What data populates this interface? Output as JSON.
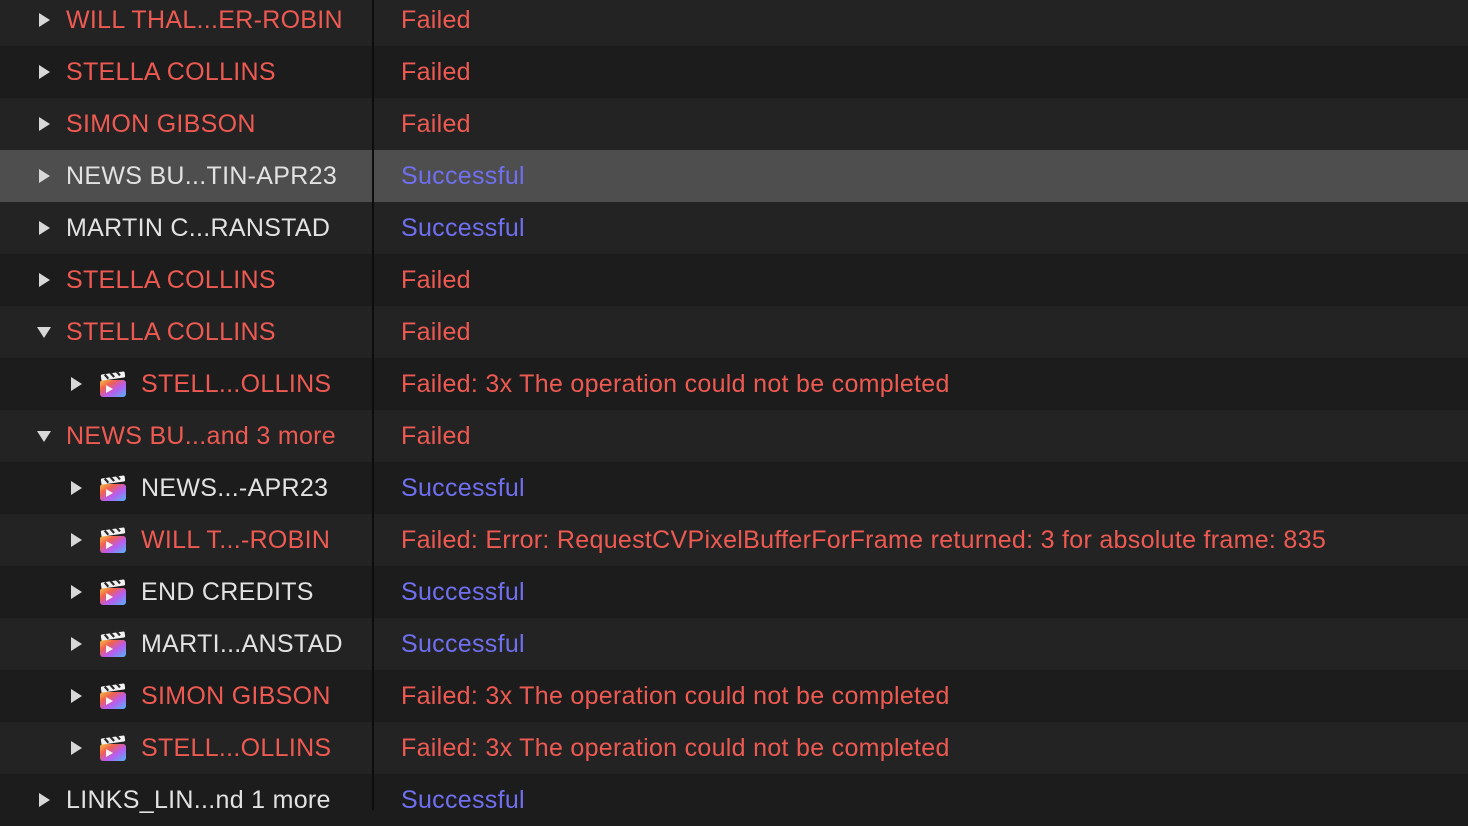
{
  "rows": [
    {
      "name": "WILL THAL...ER-ROBIN",
      "status": "Failed",
      "state": "failed",
      "depth": 0,
      "expanded": false,
      "clip": false,
      "selected": false
    },
    {
      "name": "STELLA COLLINS",
      "status": "Failed",
      "state": "failed",
      "depth": 0,
      "expanded": false,
      "clip": false,
      "selected": false
    },
    {
      "name": "SIMON GIBSON",
      "status": "Failed",
      "state": "failed",
      "depth": 0,
      "expanded": false,
      "clip": false,
      "selected": false
    },
    {
      "name": "NEWS BU...TIN-APR23",
      "status": "Successful",
      "state": "successful",
      "depth": 0,
      "expanded": false,
      "clip": false,
      "selected": true
    },
    {
      "name": "MARTIN C...RANSTAD",
      "status": "Successful",
      "state": "successful",
      "depth": 0,
      "expanded": false,
      "clip": false,
      "selected": false
    },
    {
      "name": "STELLA COLLINS",
      "status": "Failed",
      "state": "failed",
      "depth": 0,
      "expanded": false,
      "clip": false,
      "selected": false
    },
    {
      "name": "STELLA COLLINS",
      "status": "Failed",
      "state": "failed",
      "depth": 0,
      "expanded": true,
      "clip": false,
      "selected": false
    },
    {
      "name": "STELL...OLLINS",
      "status": "Failed: 3x The operation could not be completed",
      "state": "failed",
      "depth": 1,
      "expanded": false,
      "clip": true,
      "selected": false
    },
    {
      "name": "NEWS BU...and 3 more",
      "status": "Failed",
      "state": "failed",
      "depth": 0,
      "expanded": true,
      "clip": false,
      "selected": false
    },
    {
      "name": "NEWS...-APR23",
      "status": "Successful",
      "state": "successful",
      "depth": 1,
      "expanded": false,
      "clip": true,
      "selected": false
    },
    {
      "name": "WILL T...-ROBIN",
      "status": "Failed: Error: RequestCVPixelBufferForFrame returned: 3 for absolute frame: 835",
      "state": "failed",
      "depth": 1,
      "expanded": false,
      "clip": true,
      "selected": false
    },
    {
      "name": "END CREDITS",
      "status": "Successful",
      "state": "successful",
      "depth": 1,
      "expanded": false,
      "clip": true,
      "selected": false
    },
    {
      "name": "MARTI...ANSTAD",
      "status": "Successful",
      "state": "successful",
      "depth": 1,
      "expanded": false,
      "clip": true,
      "selected": false
    },
    {
      "name": "SIMON GIBSON",
      "status": "Failed: 3x The operation could not be completed",
      "state": "failed",
      "depth": 1,
      "expanded": false,
      "clip": true,
      "selected": false
    },
    {
      "name": "STELL...OLLINS",
      "status": "Failed: 3x The operation could not be completed",
      "state": "failed",
      "depth": 1,
      "expanded": false,
      "clip": true,
      "selected": false
    },
    {
      "name": "LINKS_LIN...nd 1 more",
      "status": "Successful",
      "state": "successful",
      "depth": 0,
      "expanded": false,
      "clip": false,
      "selected": false
    }
  ],
  "colors": {
    "failed": "#ee5a52",
    "successful": "#6f6ff0",
    "name_ok": "#e2e2e2",
    "selected_row": "#4e4e4e"
  },
  "icons": {
    "collapsed": "disclosure-triangle-right-icon",
    "expanded": "disclosure-triangle-down-icon",
    "clip": "final-cut-project-clapper-icon"
  }
}
